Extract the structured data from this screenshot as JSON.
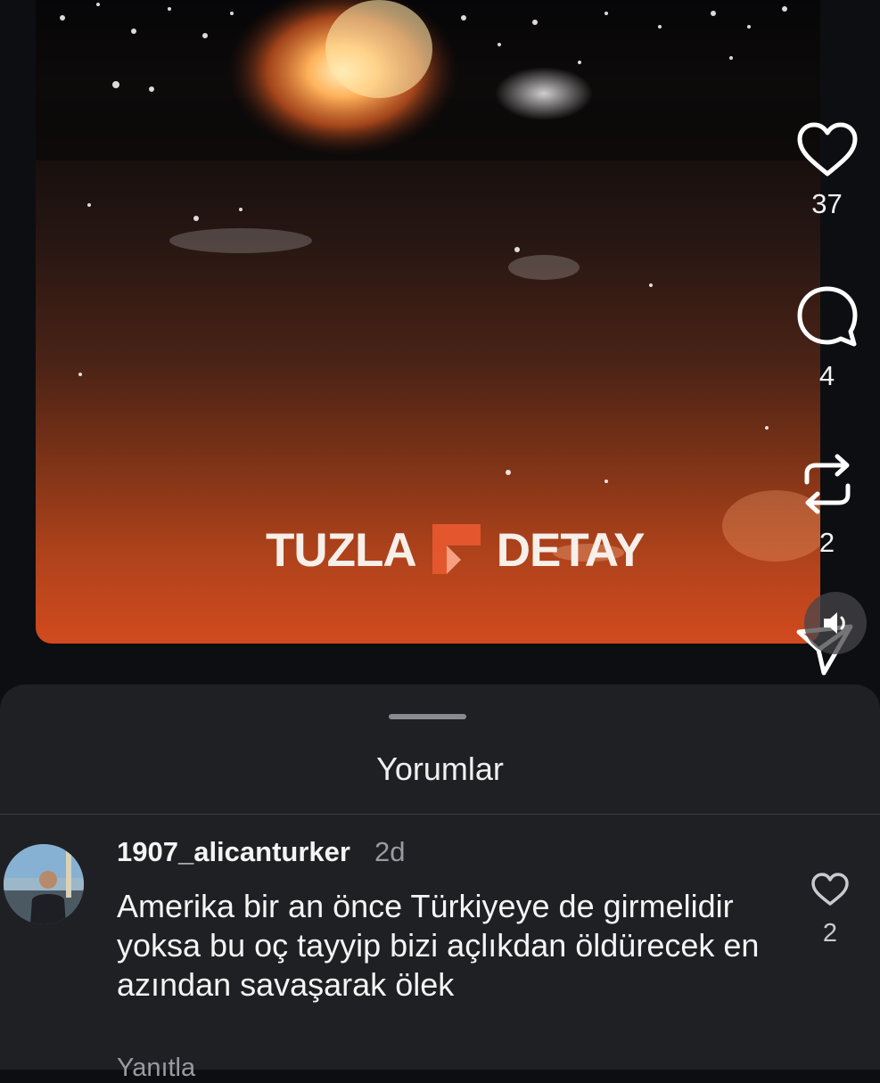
{
  "post": {
    "watermark_left": "TUZLA",
    "watermark_right": "DETAY",
    "likes": "37",
    "comments": "4",
    "reposts": "2"
  },
  "comments_sheet": {
    "title": "Yorumlar",
    "comments": [
      {
        "username": "1907_alicanturker",
        "time": "2d",
        "text": "Amerika bir an önce Türkiyeye de girmelidir yoksa bu oç tayyip bizi açlıkdan öldürecek en azından savaşarak ölek",
        "likes": "2",
        "reply_label": "Yanıtla"
      }
    ]
  },
  "colors": {
    "background": "#0d0e12",
    "sheet": "#1f2024",
    "accent_orange": "#e4572e"
  },
  "icons": [
    "heart-icon",
    "comment-icon",
    "repost-icon",
    "send-icon",
    "sound-icon"
  ]
}
